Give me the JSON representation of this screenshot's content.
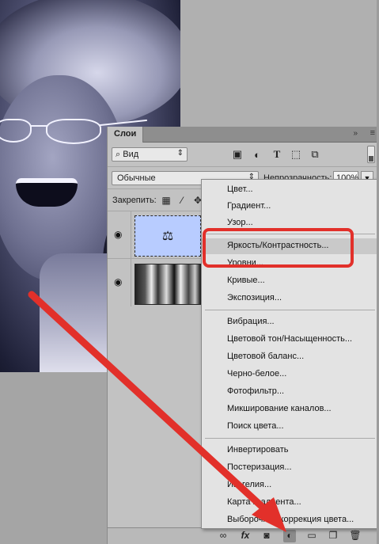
{
  "panel": {
    "tab_title": "Слои",
    "collapse_glyph": "»",
    "menu_glyph": "≡",
    "filter": {
      "kind_label": "Вид",
      "kind_icon": "search-icon"
    },
    "filter_icons": [
      "image-filter-icon",
      "adjustment-filter-icon",
      "type-filter-icon",
      "shape-filter-icon",
      "smart-object-filter-icon"
    ],
    "blend_mode": "Обычные",
    "opacity_label": "Непрозрачность:",
    "opacity_value": "100%",
    "lock_label": "Закрепить:",
    "layers": [
      {
        "kind": "adjustment",
        "visible": true,
        "thumb_glyph": "⚖"
      },
      {
        "kind": "image",
        "visible": true
      }
    ],
    "bottom_icons": [
      "link-icon",
      "fx-icon",
      "mask-icon",
      "adjustment-layer-icon",
      "group-icon",
      "new-layer-icon",
      "trash-icon"
    ],
    "fx_label": "fx"
  },
  "menu": {
    "groups": [
      [
        "Цвет...",
        "Градиент...",
        "Узор..."
      ],
      [
        "Яркость/Контрастность...",
        "Уровни...",
        "Кривые...",
        "Экспозиция..."
      ],
      [
        "Вибрация...",
        "Цветовой тон/Насыщенность...",
        "Цветовой баланс...",
        "Черно-белое...",
        "Фотофильтр...",
        "Микширование каналов...",
        "Поиск цвета..."
      ],
      [
        "Инвертировать",
        "Постеризация...",
        "Изогелия...",
        "Карта градиента...",
        "Выборочная коррекция цвета..."
      ]
    ],
    "highlighted": "Яркость/Контрастность..."
  },
  "annotation": {
    "color": "#e2302a"
  }
}
